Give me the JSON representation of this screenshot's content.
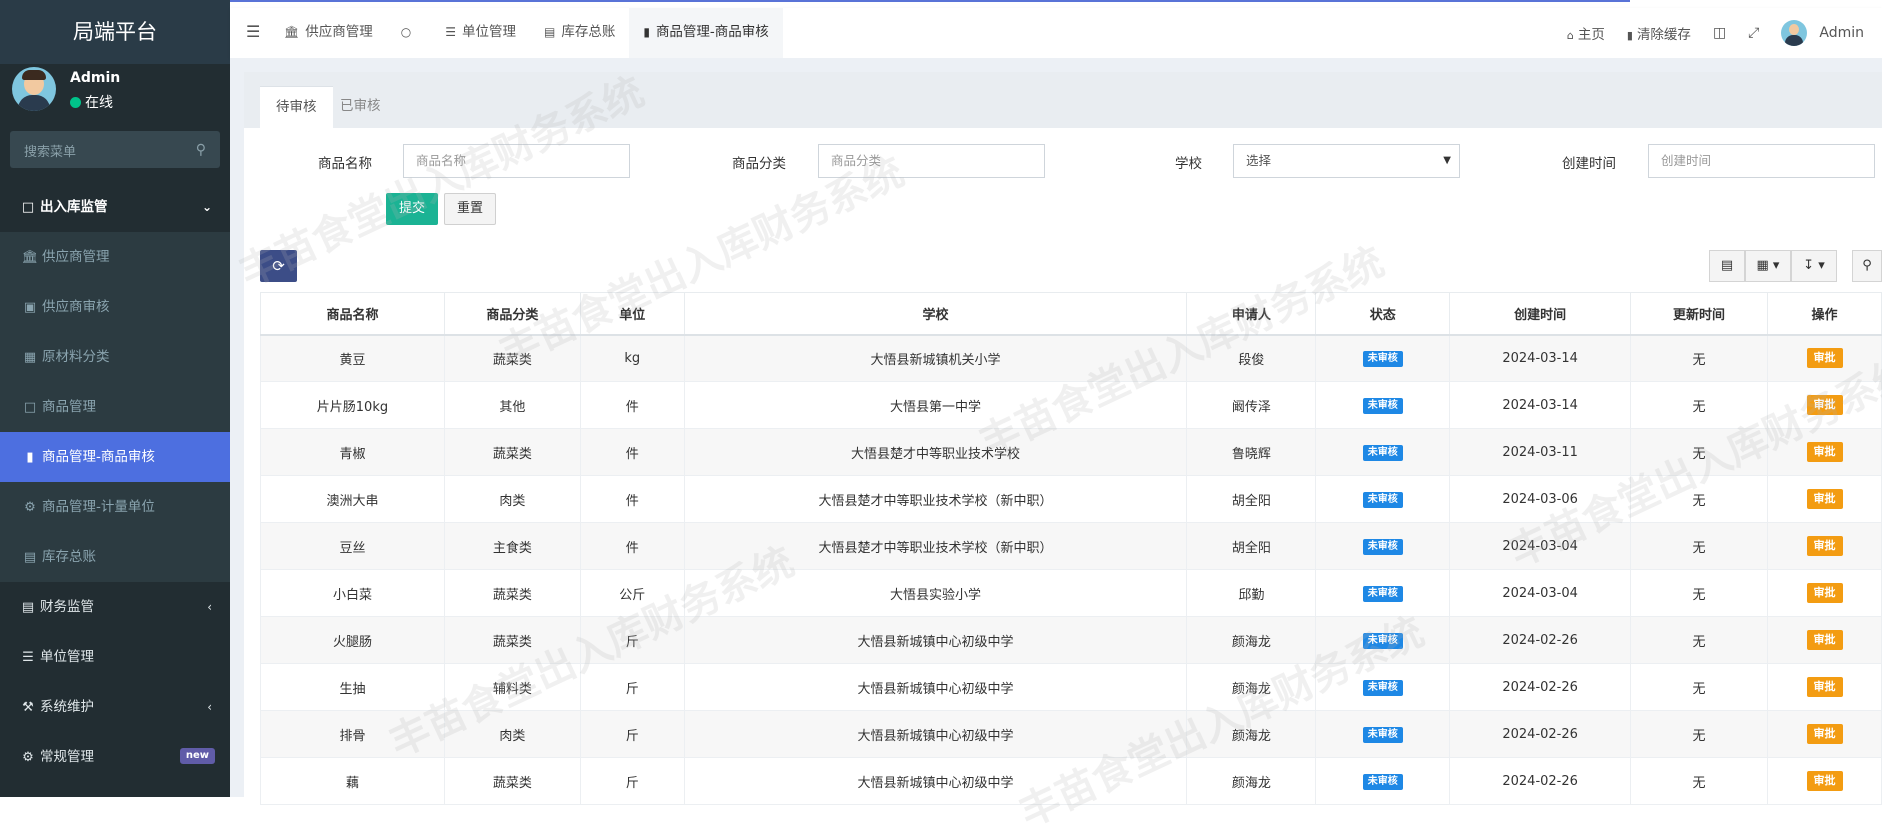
{
  "app": {
    "title": "局端平台"
  },
  "user": {
    "name": "Admin",
    "status": "在线"
  },
  "search": {
    "placeholder": "搜索菜单"
  },
  "sidebar": {
    "group_open": "出入库监管",
    "sub_items": [
      {
        "label": "供应商管理",
        "icon": "bank-icon"
      },
      {
        "label": "供应商审核",
        "icon": "archive-icon"
      },
      {
        "label": "原材料分类",
        "icon": "grid-icon"
      },
      {
        "label": "商品管理",
        "icon": "square-icon"
      },
      {
        "label": "商品管理-商品审核",
        "icon": "bookmark-icon"
      },
      {
        "label": "商品管理-计量单位",
        "icon": "cog-icon"
      },
      {
        "label": "库存总账",
        "icon": "file-icon"
      }
    ],
    "items": [
      {
        "label": "财务监管",
        "icon": "file-icon"
      },
      {
        "label": "单位管理",
        "icon": "list-icon"
      },
      {
        "label": "系统维护",
        "icon": "wrench-icon"
      },
      {
        "label": "常规管理",
        "icon": "cogs-icon",
        "badge": "new"
      }
    ]
  },
  "header": {
    "tabs": [
      {
        "label": "供应商管理",
        "icon": "bank-icon"
      },
      {
        "label": "",
        "icon": "circle-icon"
      },
      {
        "label": "单位管理",
        "icon": "list-icon"
      },
      {
        "label": "库存总账",
        "icon": "file-icon"
      },
      {
        "label": "商品管理-商品审核",
        "icon": "bookmark-icon"
      }
    ],
    "home": "主页",
    "clear_cache": "清除缓存",
    "admin": "Admin"
  },
  "subtabs": {
    "pending": "待审核",
    "done": "已审核"
  },
  "form": {
    "name_label": "商品名称",
    "name_placeholder": "商品名称",
    "category_label": "商品分类",
    "category_placeholder": "商品分类",
    "school_label": "学校",
    "school_value": "选择",
    "created_label": "创建时间",
    "created_placeholder": "创建时间",
    "submit": "提交",
    "reset": "重置"
  },
  "table": {
    "columns": [
      "商品名称",
      "商品分类",
      "单位",
      "学校",
      "申请人",
      "状态",
      "创建时间",
      "更新时间",
      "操作"
    ],
    "rows": [
      [
        "黄豆",
        "蔬菜类",
        "kg",
        "大悟县新城镇机关小学",
        "段俊",
        "未审核",
        "2024-03-14",
        "无",
        "审批"
      ],
      [
        "片片肠10kg",
        "其他",
        "件",
        "大悟县第一中学",
        "阚传泽",
        "未审核",
        "2024-03-14",
        "无",
        "审批"
      ],
      [
        "青椒",
        "蔬菜类",
        "件",
        "大悟县楚才中等职业技术学校",
        "鲁晓辉",
        "未审核",
        "2024-03-11",
        "无",
        "审批"
      ],
      [
        "澳洲大串",
        "肉类",
        "件",
        "大悟县楚才中等职业技术学校（新中职）",
        "胡全阳",
        "未审核",
        "2024-03-06",
        "无",
        "审批"
      ],
      [
        "豆丝",
        "主食类",
        "件",
        "大悟县楚才中等职业技术学校（新中职）",
        "胡全阳",
        "未审核",
        "2024-03-04",
        "无",
        "审批"
      ],
      [
        "小白菜",
        "蔬菜类",
        "公斤",
        "大悟县实验小学",
        "邱勤",
        "未审核",
        "2024-03-04",
        "无",
        "审批"
      ],
      [
        "火腿肠",
        "蔬菜类",
        "斤",
        "大悟县新城镇中心初级中学",
        "颜海龙",
        "未审核",
        "2024-02-26",
        "无",
        "审批"
      ],
      [
        "生抽",
        "辅料类",
        "斤",
        "大悟县新城镇中心初级中学",
        "颜海龙",
        "未审核",
        "2024-02-26",
        "无",
        "审批"
      ],
      [
        "排骨",
        "肉类",
        "斤",
        "大悟县新城镇中心初级中学",
        "颜海龙",
        "未审核",
        "2024-02-26",
        "无",
        "审批"
      ],
      [
        "藕",
        "蔬菜类",
        "斤",
        "大悟县新城镇中心初级中学",
        "颜海龙",
        "未审核",
        "2024-02-26",
        "无",
        "审批"
      ]
    ]
  },
  "watermark": "丰苗食堂出入库财务系统",
  "colors": {
    "sidebar": "#222d32",
    "active": "#4d6fe0",
    "submit": "#1bb394",
    "status": "#1e88e5",
    "action": "#f39c12"
  }
}
